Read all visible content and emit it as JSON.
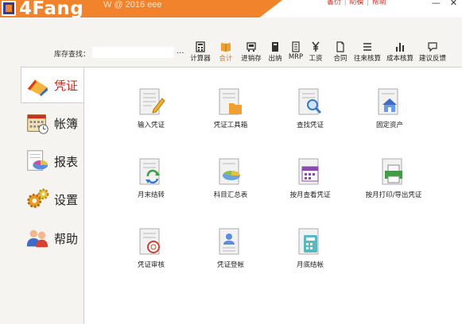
{
  "titlebar": {
    "logo": "4Fang",
    "title": "W @ 2016 eee",
    "links": [
      "書衍",
      "助模",
      "帮助"
    ],
    "min": "—",
    "close": "✕"
  },
  "toolbar": {
    "search_label": "库存查找：",
    "search_value": "",
    "search_more": "...",
    "items": [
      {
        "label": "计算器",
        "icon": "calculator-icon"
      },
      {
        "label": "会计",
        "icon": "book-icon"
      },
      {
        "label": "进销存",
        "icon": "cart-icon"
      },
      {
        "label": "出纳",
        "icon": "cashier-icon"
      },
      {
        "label": "MRP",
        "icon": "document-icon"
      },
      {
        "label": "工资",
        "icon": "yen-icon"
      },
      {
        "label": "合同",
        "icon": "contract-icon"
      },
      {
        "label": "往来核算",
        "icon": "list-icon"
      },
      {
        "label": "成本核算",
        "icon": "bar-chart-icon"
      },
      {
        "label": "建议反馈",
        "icon": "feedback-icon"
      }
    ]
  },
  "nav": [
    {
      "label": "凭证"
    },
    {
      "label": "帐簿"
    },
    {
      "label": "报表"
    },
    {
      "label": "设置"
    },
    {
      "label": "帮助"
    }
  ],
  "grid": [
    {
      "label": "输入凭证"
    },
    {
      "label": "凭证工具箱"
    },
    {
      "label": "查找凭证"
    },
    {
      "label": "固定资产"
    },
    {
      "label": "月末结转"
    },
    {
      "label": "科目汇总表"
    },
    {
      "label": "按月查看凭证"
    },
    {
      "label": "按月打印/导出凭证"
    },
    {
      "label": "凭证审核"
    },
    {
      "label": "凭证登帐"
    },
    {
      "label": "月底结帐"
    }
  ],
  "colors": {
    "accent": "#f0832b",
    "active_nav": "#d02018",
    "brand_blue": "#2e3e9a"
  }
}
